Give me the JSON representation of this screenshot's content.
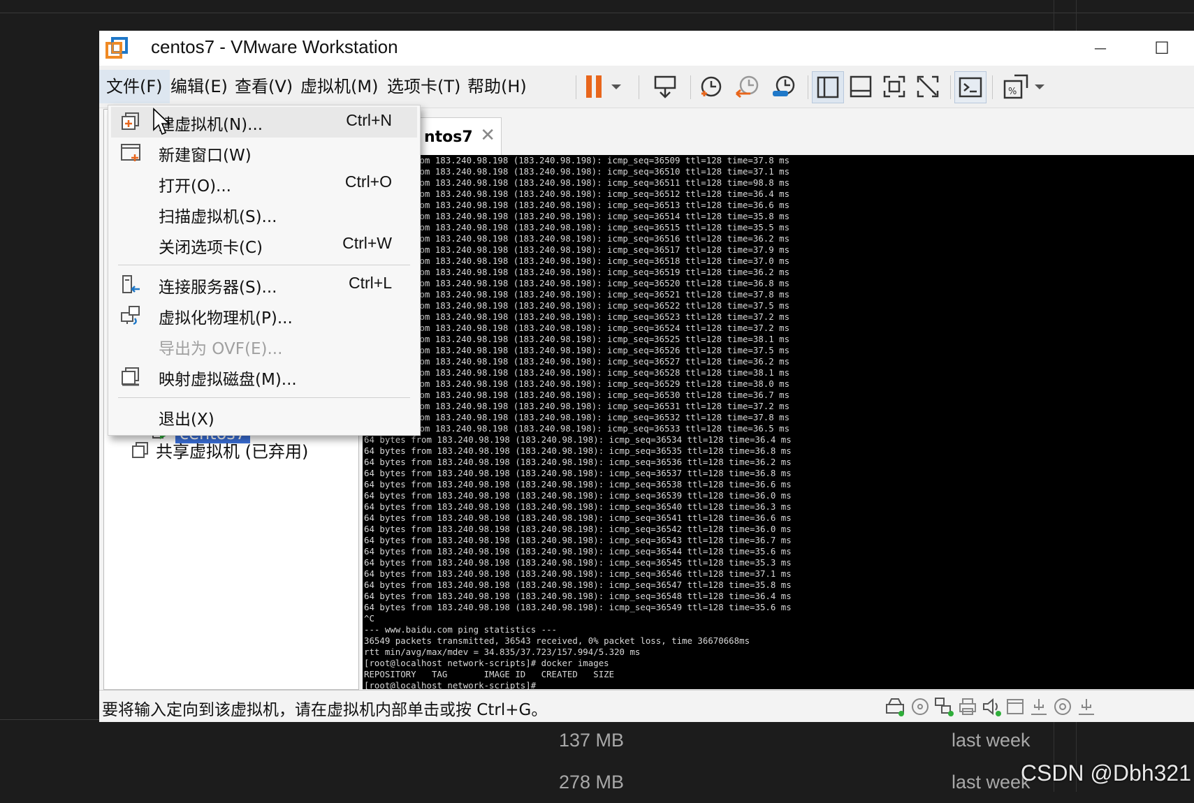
{
  "window": {
    "title": "centos7 - VMware Workstation",
    "minimize": "—",
    "maximize": "☐"
  },
  "menu": {
    "file": "文件(F)",
    "edit": "编辑(E)",
    "view": "查看(V)",
    "vm": "虚拟机(M)",
    "tabs": "选项卡(T)",
    "help": "帮助(H)"
  },
  "file_menu": {
    "items": [
      {
        "label": "建虚拟机(N)...",
        "shortcut": "Ctrl+N",
        "icon": "new-vm-icon"
      },
      {
        "label": "新建窗口(W)",
        "shortcut": "",
        "icon": "new-window-icon"
      },
      {
        "label": "打开(O)...",
        "shortcut": "Ctrl+O",
        "icon": ""
      },
      {
        "label": "扫描虚拟机(S)...",
        "shortcut": "",
        "icon": ""
      },
      {
        "label": "关闭选项卡(C)",
        "shortcut": "Ctrl+W",
        "icon": ""
      },
      {
        "label": "连接服务器(S)...",
        "shortcut": "Ctrl+L",
        "icon": "connect-server-icon"
      },
      {
        "label": "虚拟化物理机(P)...",
        "shortcut": "",
        "icon": "virtualize-physical-icon"
      },
      {
        "label": "导出为 OVF(E)...",
        "shortcut": "",
        "icon": "",
        "disabled": true
      },
      {
        "label": "映射虚拟磁盘(M)...",
        "shortcut": "",
        "icon": "map-disk-icon"
      },
      {
        "label": "退出(X)",
        "shortcut": "",
        "icon": ""
      }
    ]
  },
  "library": {
    "selected_vm": "centos7",
    "shared": "共享虚拟机 (已弃用)"
  },
  "tab": {
    "label": "ntos7",
    "close": "✕"
  },
  "console": {
    "lines": [
      "rom 183.240.98.198 (183.240.98.198): icmp_seq=36509 ttl=128 time=37.8 ms",
      "rom 183.240.98.198 (183.240.98.198): icmp_seq=36510 ttl=128 time=37.1 ms",
      "rom 183.240.98.198 (183.240.98.198): icmp_seq=36511 ttl=128 time=98.8 ms",
      "rom 183.240.98.198 (183.240.98.198): icmp_seq=36512 ttl=128 time=36.4 ms",
      "rom 183.240.98.198 (183.240.98.198): icmp_seq=36513 ttl=128 time=36.6 ms",
      "rom 183.240.98.198 (183.240.98.198): icmp_seq=36514 ttl=128 time=35.8 ms",
      "rom 183.240.98.198 (183.240.98.198): icmp_seq=36515 ttl=128 time=35.5 ms",
      "rom 183.240.98.198 (183.240.98.198): icmp_seq=36516 ttl=128 time=36.2 ms",
      "rom 183.240.98.198 (183.240.98.198): icmp_seq=36517 ttl=128 time=37.9 ms",
      "rom 183.240.98.198 (183.240.98.198): icmp_seq=36518 ttl=128 time=37.0 ms",
      "rom 183.240.98.198 (183.240.98.198): icmp_seq=36519 ttl=128 time=36.2 ms",
      "rom 183.240.98.198 (183.240.98.198): icmp_seq=36520 ttl=128 time=36.8 ms",
      "rom 183.240.98.198 (183.240.98.198): icmp_seq=36521 ttl=128 time=37.8 ms",
      "rom 183.240.98.198 (183.240.98.198): icmp_seq=36522 ttl=128 time=37.5 ms",
      "rom 183.240.98.198 (183.240.98.198): icmp_seq=36523 ttl=128 time=37.2 ms",
      "rom 183.240.98.198 (183.240.98.198): icmp_seq=36524 ttl=128 time=37.2 ms",
      "rom 183.240.98.198 (183.240.98.198): icmp_seq=36525 ttl=128 time=38.1 ms",
      "rom 183.240.98.198 (183.240.98.198): icmp_seq=36526 ttl=128 time=37.5 ms",
      "rom 183.240.98.198 (183.240.98.198): icmp_seq=36527 ttl=128 time=36.2 ms",
      "rom 183.240.98.198 (183.240.98.198): icmp_seq=36528 ttl=128 time=38.1 ms",
      "rom 183.240.98.198 (183.240.98.198): icmp_seq=36529 ttl=128 time=38.0 ms",
      "rom 183.240.98.198 (183.240.98.198): icmp_seq=36530 ttl=128 time=36.7 ms",
      "rom 183.240.98.198 (183.240.98.198): icmp_seq=36531 ttl=128 time=37.2 ms",
      "rom 183.240.98.198 (183.240.98.198): icmp_seq=36532 ttl=128 time=37.8 ms",
      "rom 183.240.98.198 (183.240.98.198): icmp_seq=36533 ttl=128 time=36.5 ms",
      "64 bytes from 183.240.98.198 (183.240.98.198): icmp_seq=36534 ttl=128 time=36.4 ms",
      "64 bytes from 183.240.98.198 (183.240.98.198): icmp_seq=36535 ttl=128 time=36.8 ms",
      "64 bytes from 183.240.98.198 (183.240.98.198): icmp_seq=36536 ttl=128 time=36.2 ms",
      "64 bytes from 183.240.98.198 (183.240.98.198): icmp_seq=36537 ttl=128 time=36.8 ms",
      "64 bytes from 183.240.98.198 (183.240.98.198): icmp_seq=36538 ttl=128 time=36.6 ms",
      "64 bytes from 183.240.98.198 (183.240.98.198): icmp_seq=36539 ttl=128 time=36.0 ms",
      "64 bytes from 183.240.98.198 (183.240.98.198): icmp_seq=36540 ttl=128 time=36.3 ms",
      "64 bytes from 183.240.98.198 (183.240.98.198): icmp_seq=36541 ttl=128 time=36.6 ms",
      "64 bytes from 183.240.98.198 (183.240.98.198): icmp_seq=36542 ttl=128 time=36.0 ms",
      "64 bytes from 183.240.98.198 (183.240.98.198): icmp_seq=36543 ttl=128 time=36.7 ms",
      "64 bytes from 183.240.98.198 (183.240.98.198): icmp_seq=36544 ttl=128 time=35.6 ms",
      "64 bytes from 183.240.98.198 (183.240.98.198): icmp_seq=36545 ttl=128 time=35.3 ms",
      "64 bytes from 183.240.98.198 (183.240.98.198): icmp_seq=36546 ttl=128 time=37.1 ms",
      "64 bytes from 183.240.98.198 (183.240.98.198): icmp_seq=36547 ttl=128 time=35.8 ms",
      "64 bytes from 183.240.98.198 (183.240.98.198): icmp_seq=36548 ttl=128 time=36.4 ms",
      "64 bytes from 183.240.98.198 (183.240.98.198): icmp_seq=36549 ttl=128 time=35.6 ms",
      "^C",
      "--- www.baidu.com ping statistics ---",
      "36549 packets transmitted, 36543 received, 0% packet loss, time 36670668ms",
      "rtt min/avg/max/mdev = 34.835/37.723/157.994/5.320 ms",
      "[root@localhost network-scripts]# docker images",
      "REPOSITORY   TAG       IMAGE ID   CREATED   SIZE",
      "[root@localhost network-scripts]#"
    ]
  },
  "statusbar": {
    "message": "要将输入定向到该虚拟机，请在虚拟机内部单击或按 Ctrl+G。"
  },
  "background_app": {
    "rows": [
      {
        "size": "137 MB",
        "when": "last week"
      },
      {
        "size": "278 MB",
        "when": "last week"
      }
    ]
  },
  "watermark": "CSDN @Dbh321",
  "colors": {
    "pause_accent": "#e8661c",
    "selection": "#3a6fd8",
    "logo_orange": "#f08a24",
    "logo_blue": "#1f78c8"
  }
}
